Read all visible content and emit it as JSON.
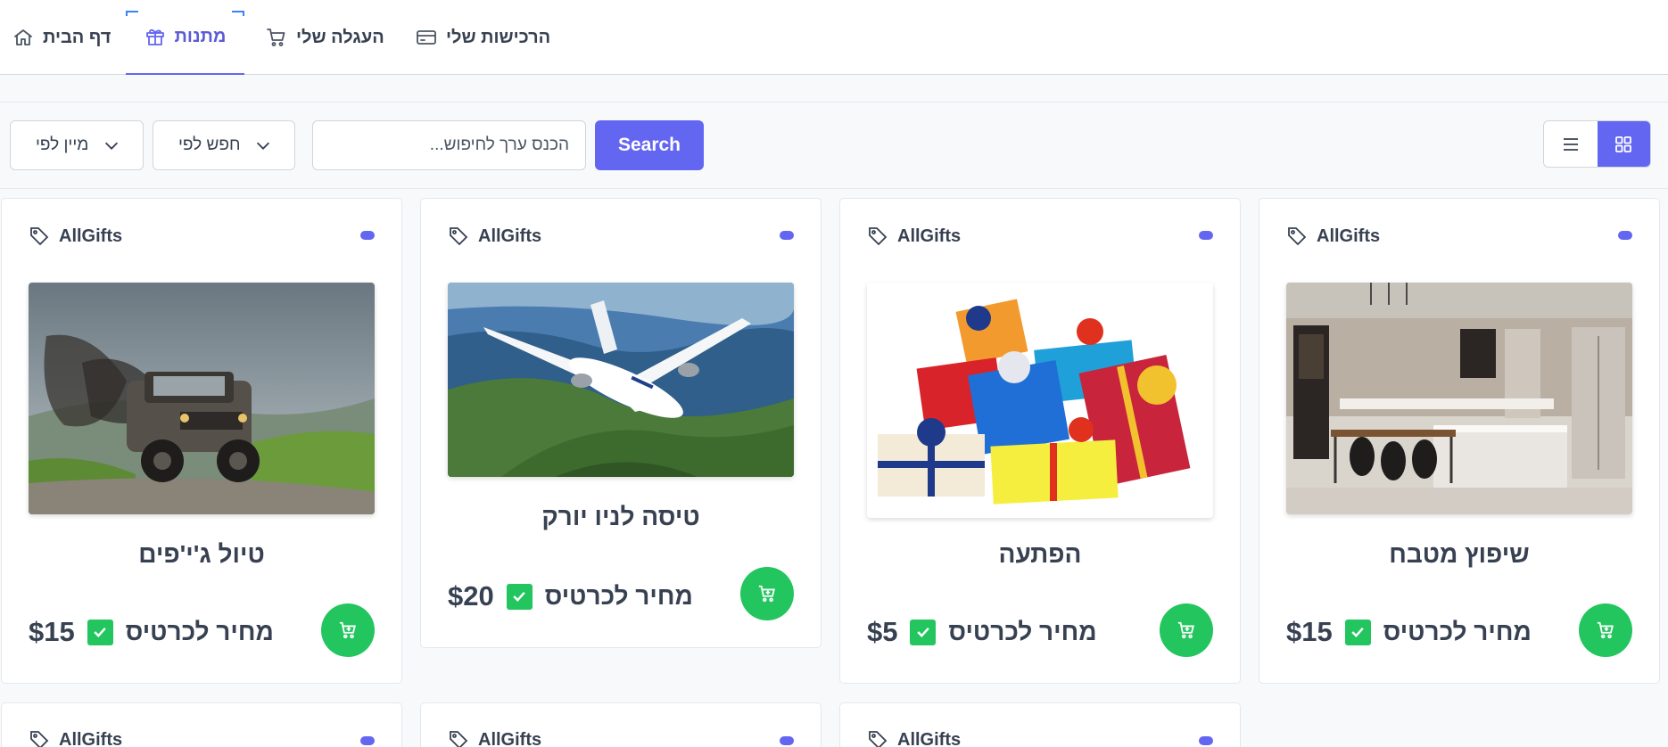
{
  "nav": {
    "home": "דף הבית",
    "gifts": "מתנות",
    "cart": "העגלה שלי",
    "purchases": "הרכישות שלי"
  },
  "toolbar": {
    "sort_label": "מיין לפי",
    "search_by_label": "חפש לפי",
    "search_placeholder": "הכנס ערך לחיפוש...",
    "search_button": "Search"
  },
  "cards": [
    {
      "vendor": "AllGifts",
      "title": "טיול ג'י'פים",
      "price_label": "מחיר לכרטיס",
      "price": "$15"
    },
    {
      "vendor": "AllGifts",
      "title": "טיסה לניו יורק",
      "price_label": "מחיר לכרטיס",
      "price": "$20"
    },
    {
      "vendor": "AllGifts",
      "title": "הפתעה",
      "price_label": "מחיר לכרטיס",
      "price": "$5"
    },
    {
      "vendor": "AllGifts",
      "title": "שיפוץ מטבח",
      "price_label": "מחיר לכרטיס",
      "price": "$15"
    },
    {
      "vendor": "AllGifts"
    },
    {
      "vendor": "AllGifts"
    },
    {
      "vendor": "AllGifts"
    }
  ],
  "colors": {
    "accent": "#6366f1",
    "success": "#22c55e"
  }
}
